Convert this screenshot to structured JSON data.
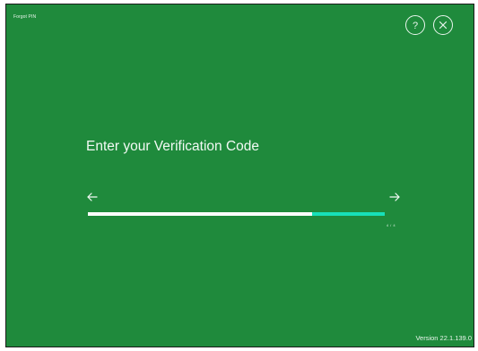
{
  "window": {
    "title": "Forgot PIN",
    "background_color": "#1f8a3c"
  },
  "header": {
    "help_icon": "question-circle-icon",
    "close_icon": "close-circle-icon"
  },
  "main": {
    "heading": "Enter your Verification Code",
    "back_icon": "arrow-left-icon",
    "forward_icon": "arrow-right-icon",
    "progress": {
      "filled_fraction": 0.754,
      "remaining_color": "#ffffff",
      "active_color": "#17e0b9"
    },
    "step_counter": "4 / 4"
  },
  "footer": {
    "version": "Version 22.1.139.0"
  }
}
